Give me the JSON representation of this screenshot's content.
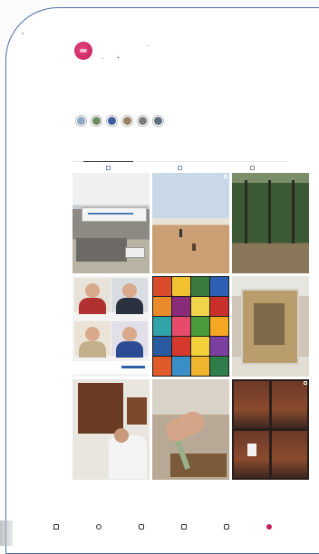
{
  "status_bar": {
    "center_text": ""
  },
  "header": {
    "back_glyph": "‹",
    "username": "",
    "avatar_color": "#c41d5c",
    "username_chevron": "⌄"
  },
  "actions": {
    "follow_label": "",
    "follow_chevron": "⌄",
    "message_label": "",
    "add_person_glyph": "+"
  },
  "bio": {
    "name": "",
    "lines": [
      "",
      "",
      "",
      "",
      "",
      ""
    ]
  },
  "followed_by": "",
  "highlights": [
    {
      "label": "",
      "color": "#8fa7c2"
    },
    {
      "label": "",
      "color": "#6e8a60"
    },
    {
      "label": "",
      "color": "#3f5fa0"
    },
    {
      "label": "",
      "color": "#9a8064"
    },
    {
      "label": "",
      "color": "#7c7c7c"
    },
    {
      "label": "",
      "color": "#5e6e7c"
    }
  ],
  "stats": [
    {
      "number": "",
      "label": ""
    },
    {
      "number": "",
      "label": ""
    },
    {
      "number": "",
      "label": ""
    }
  ],
  "tabs": [
    {
      "icon": "grid-icon",
      "active": true
    },
    {
      "icon": "reels-icon",
      "active": false
    },
    {
      "icon": "tagged-icon",
      "active": false
    }
  ],
  "grid_posts": [
    {
      "subject": "building-with-sign",
      "multi": false
    },
    {
      "subject": "beach-with-people",
      "multi": true
    },
    {
      "subject": "forest",
      "multi": false
    },
    {
      "subject": "four-portraits",
      "multi": false
    },
    {
      "subject": "colorful-painting-grid",
      "multi": false
    },
    {
      "subject": "artwork-in-tray",
      "multi": false
    },
    {
      "subject": "man-with-painting",
      "multi": false
    },
    {
      "subject": "hand-with-brush",
      "multi": false
    },
    {
      "subject": "four-dark-paintings",
      "multi": true
    }
  ],
  "bottom_nav": [
    {
      "icon": "home-icon"
    },
    {
      "icon": "explore-icon"
    },
    {
      "icon": "reels-icon"
    },
    {
      "icon": "shop-icon"
    },
    {
      "icon": "add-post-icon"
    },
    {
      "icon": "profile-icon"
    }
  ],
  "palette": {
    "frame_border": "#4a6fa8",
    "link_blue": "#2b4a88",
    "brand_pink": "#c41d5c"
  }
}
